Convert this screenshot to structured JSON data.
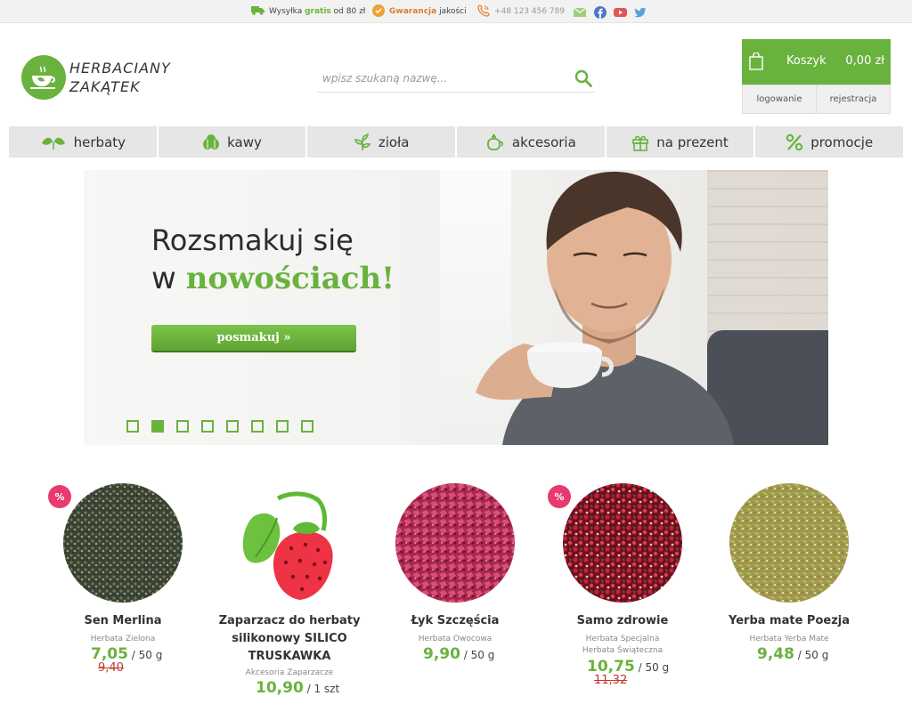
{
  "topbar": {
    "shipping_pre": "Wysyłka",
    "shipping_highlight": "gratis",
    "shipping_post": "od 80 zł",
    "quality_highlight": "Gwarancja",
    "quality_post": "jakości",
    "phone": "+48 123 456 789",
    "social": [
      "mail-icon",
      "facebook-icon",
      "youtube-icon",
      "twitter-icon"
    ]
  },
  "logo": {
    "line1": "HERBACIANY",
    "line2": "ZAKĄTEK"
  },
  "search": {
    "placeholder": "wpisz szukaną nazwę..."
  },
  "cart": {
    "label": "Koszyk",
    "total": "0,00 zł"
  },
  "account": {
    "login": "logowanie",
    "register": "rejestracja"
  },
  "nav": [
    {
      "label": "herbaty",
      "icon": "tea-leaves-icon"
    },
    {
      "label": "kawy",
      "icon": "coffee-beans-icon"
    },
    {
      "label": "zioła",
      "icon": "herb-icon"
    },
    {
      "label": "akcesoria",
      "icon": "teapot-icon"
    },
    {
      "label": "na prezent",
      "icon": "gift-icon"
    },
    {
      "label": "promocje",
      "icon": "percent-icon"
    }
  ],
  "banner": {
    "line1": "Rozsmakuj się",
    "line2_pre": "w",
    "line2_highlight": "nowościach!",
    "button": "posmakuj »",
    "slide_count": 8,
    "active_slide": 2
  },
  "products": [
    {
      "name": "Sen Merlina",
      "category": "Herbata Zielona",
      "price": "7,05",
      "unit": "/ 50 g",
      "old_price": "9,40",
      "promo": true,
      "badge": "%"
    },
    {
      "name": "Zaparzacz do herbaty silikonowy SILICO TRUSKAWKA",
      "name_l1": "Zaparzacz do herbaty",
      "name_l2": "silikonowy SILICO",
      "name_l3": "TRUSKAWKA",
      "category": "Akcesoria Zaparzacze",
      "price": "10,90",
      "unit": "/ 1 szt",
      "old_price": "",
      "promo": false,
      "badge": ""
    },
    {
      "name": "Łyk Szczęścia",
      "category": "Herbata Owocowa",
      "price": "9,90",
      "unit": "/ 50 g",
      "old_price": "",
      "promo": false,
      "badge": ""
    },
    {
      "name": "Samo zdrowie",
      "category": "Herbata Specjalna",
      "category2": "Herbata Świąteczna",
      "price": "10,75",
      "unit": "/ 50 g",
      "old_price": "11,32",
      "promo": true,
      "badge": "%"
    },
    {
      "name": "Yerba mate Poezja",
      "category": "Herbata Yerba Mate",
      "price": "9,48",
      "unit": "/ 50 g",
      "old_price": "",
      "promo": false,
      "badge": ""
    }
  ],
  "colors": {
    "accent": "#6ab23e",
    "promo_badge": "#e83a6f",
    "old_price": "#c0392b",
    "nav_bg": "#e6e6e6"
  }
}
